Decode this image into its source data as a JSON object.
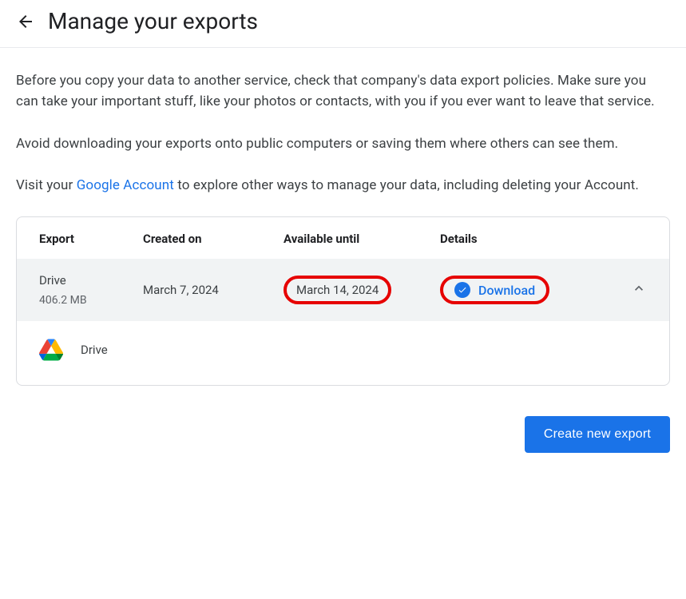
{
  "header": {
    "title": "Manage your exports"
  },
  "intro": {
    "p1": "Before you copy your data to another service, check that company's data export policies. Make sure you can take your important stuff, like your photos or contacts, with you if you ever want to leave that service.",
    "p2": "Avoid downloading your exports onto public computers or saving them where others can see them.",
    "p3_pre": "Visit your ",
    "p3_link": "Google Account",
    "p3_post": " to explore other ways to manage your data, including deleting your Account."
  },
  "table": {
    "headers": {
      "export": "Export",
      "created": "Created on",
      "until": "Available until",
      "details": "Details"
    },
    "row": {
      "name": "Drive",
      "size": "406.2 MB",
      "created": "March 7, 2024",
      "until": "March 14, 2024",
      "download": "Download"
    },
    "detail": {
      "label": "Drive"
    }
  },
  "footer": {
    "create": "Create new export"
  }
}
